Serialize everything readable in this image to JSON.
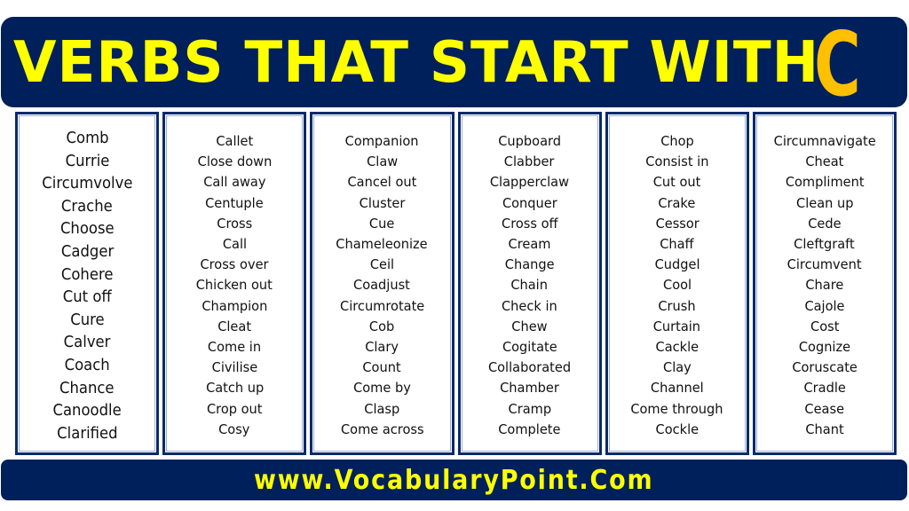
{
  "banner": {
    "title": "VERBS THAT START WITH",
    "letter": "C",
    "colors": {
      "background": "#00205b",
      "title": "#ffff00",
      "letter": "#ffc000"
    }
  },
  "columns": [
    {
      "words": [
        "Comb",
        "Currie",
        "Circumvolve",
        "Crache",
        "Choose",
        "Cadger",
        "Cohere",
        "Cut off",
        "Cure",
        "Calver",
        "Coach",
        "Chance",
        "Canoodle",
        "Clarified"
      ]
    },
    {
      "words": [
        "Callet",
        "Close down",
        "Call away",
        "Centuple",
        "Cross",
        "Call",
        "Cross over",
        "Chicken out",
        "Champion",
        "Cleat",
        "Come in",
        "Civilise",
        "Catch up",
        "Crop out",
        "Cosy"
      ]
    },
    {
      "words": [
        "Companion",
        "Claw",
        "Cancel out",
        "Cluster",
        "Cue",
        "Chameleonize",
        "Ceil",
        "Coadjust",
        "Circumrotate",
        "Cob",
        "Clary",
        "Count",
        "Come by",
        "Clasp",
        "Come across"
      ]
    },
    {
      "words": [
        "Cupboard",
        "Clabber",
        "Clapperclaw",
        "Conquer",
        "Cross off",
        "Cream",
        "Change",
        "Chain",
        "Check in",
        "Chew",
        "Cogitate",
        "Collaborated",
        "Chamber",
        "Cramp",
        "Complete"
      ]
    },
    {
      "words": [
        "Chop",
        "Consist in",
        "Cut out",
        "Crake",
        "Cessor",
        "Chaff",
        "Cudgel",
        "Cool",
        "Crush",
        "Curtain",
        "Cackle",
        "Clay",
        "Channel",
        "Come through",
        "Cockle"
      ]
    },
    {
      "words": [
        "Circumnavigate",
        "Cheat",
        "Compliment",
        "Clean up",
        "Cede",
        "Cleftgraft",
        "Circumvent",
        "Chare",
        "Cajole",
        "Cost",
        "Cognize",
        "Coruscate",
        "Cradle",
        "Cease",
        "Chant"
      ]
    }
  ],
  "footer": {
    "text": "www.VocabularyPoint.Com"
  }
}
